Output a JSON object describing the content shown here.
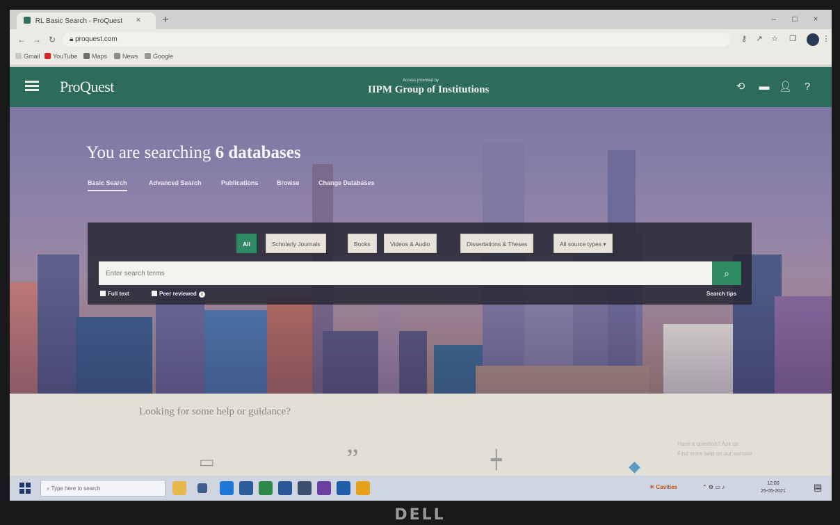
{
  "browser": {
    "tab_title": "RL Basic Search - ProQuest",
    "tab_close": "×",
    "new_tab": "+",
    "window_controls": [
      "–",
      "□",
      "×"
    ],
    "url": "proquest.com",
    "bookmarks": [
      "Gmail",
      "YouTube",
      "Maps",
      "News",
      "Google"
    ]
  },
  "app": {
    "logo": "ProQuest",
    "institution_sub": "Access provided by",
    "institution": "IIPM Group of Institutions",
    "header_icons": [
      "history-icon",
      "folder-icon",
      "user-icon",
      "help-icon"
    ]
  },
  "hero": {
    "title_prefix": "You are searching ",
    "title_bold": "6 databases",
    "tabs": [
      "Basic Search",
      "Advanced Search",
      "Publications",
      "Browse",
      "Change Databases"
    ],
    "filters": [
      "All",
      "Scholarly Journals",
      "Books",
      "Videos & Audio",
      "Dissertations & Theses",
      "All source types"
    ],
    "search_placeholder": "Enter search terms",
    "checkboxes": [
      "Full text",
      "Peer reviewed"
    ],
    "search_tips": "Search tips"
  },
  "help": {
    "title": "Looking for some help or guidance?",
    "side_note": [
      "Have a question? Ask us",
      "Find more help on our website"
    ]
  },
  "taskbar": {
    "search_placeholder": "Type here to search",
    "weather": "Cavities",
    "time": "12:00",
    "date": "25-05-2021"
  },
  "device": {
    "brand": "DELL"
  }
}
